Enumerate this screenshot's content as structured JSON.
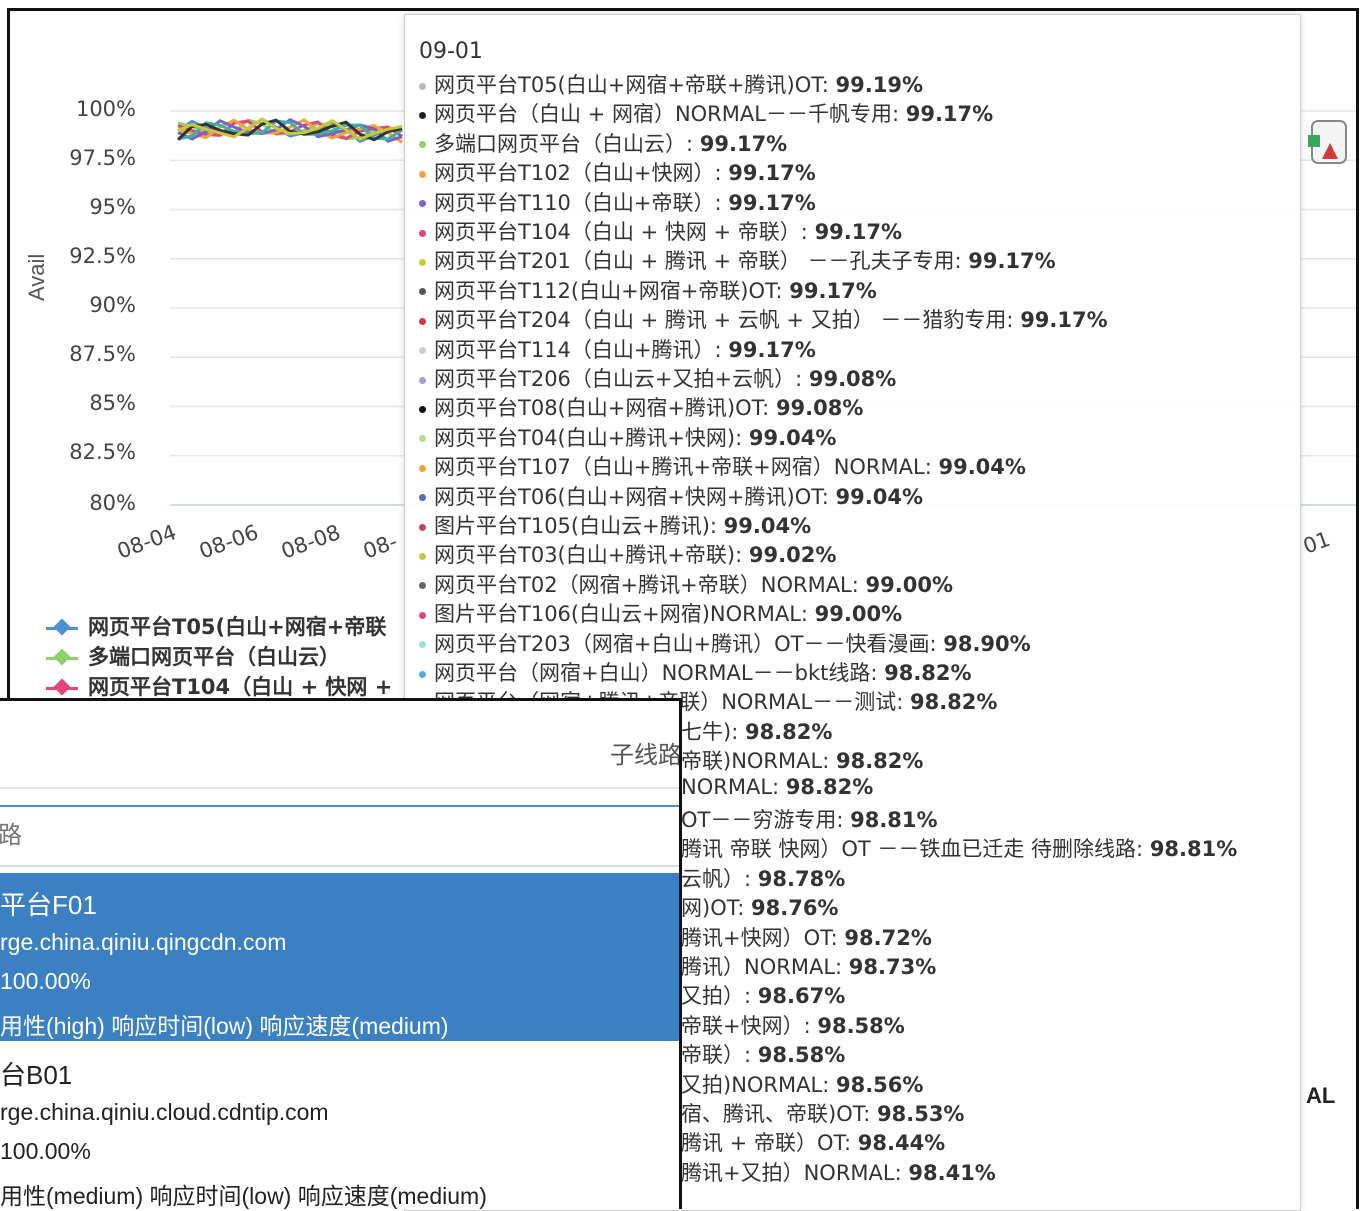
{
  "chart": {
    "y_axis_label": "Avail",
    "y_ticks": [
      "100%",
      "97.5%",
      "95%",
      "92.5%",
      "90%",
      "87.5%",
      "85%",
      "82.5%",
      "80%"
    ],
    "x_ticks": [
      "08-04",
      "08-06",
      "08-08",
      "08-",
      "01"
    ],
    "legend": [
      {
        "label": "网页平台T05(白山+网宿+帝联",
        "color": "#4f8fd6"
      },
      {
        "label": "多端口网页平台（白山云）",
        "color": "#8ed16a"
      },
      {
        "label": "网页平台T104（白山 + 快网 +",
        "color": "#e0457b"
      }
    ],
    "line_colors": [
      "#4f8fd6",
      "#8ed16a",
      "#e0457b",
      "#f2a33a",
      "#7a62c9",
      "#39b3a8",
      "#333333",
      "#c8c838"
    ]
  },
  "chart_data": {
    "type": "line",
    "ylabel": "Avail",
    "ylim": [
      80,
      100
    ],
    "yunit": "%"
  },
  "tooltip": {
    "date": "09-01",
    "rows": [
      {
        "prefix": "网页平台T05(白山+网宿+帝联+腾讯)OT: ",
        "value": "99.19%",
        "color": "#bbbbbb"
      },
      {
        "prefix": "网页平台（白山 + 网宿）NORMAL－－千帆专用: ",
        "value": "99.17%",
        "color": "#222222"
      },
      {
        "prefix": "多端口网页平台（白山云）: ",
        "value": "99.17%",
        "color": "#8ed16a"
      },
      {
        "prefix": "网页平台T102（白山+快网）: ",
        "value": "99.17%",
        "color": "#f2a33a"
      },
      {
        "prefix": "网页平台T110（白山+帝联）: ",
        "value": "99.17%",
        "color": "#7a62c9"
      },
      {
        "prefix": "网页平台T104（白山 + 快网 + 帝联）: ",
        "value": "99.17%",
        "color": "#e0457b"
      },
      {
        "prefix": "网页平台T201（白山 + 腾讯 + 帝联） －－孔夫子专用: ",
        "value": "99.17%",
        "color": "#c8c838"
      },
      {
        "prefix": "网页平台T112(白山+网宿+帝联)OT: ",
        "value": "99.17%",
        "color": "#555555"
      },
      {
        "prefix": "网页平台T204（白山 + 腾讯 + 云帆 + 又拍） －－猎豹专用: ",
        "value": "99.17%",
        "color": "#d43a3a"
      },
      {
        "prefix": "网页平台T114（白山+腾讯）: ",
        "value": "99.17%",
        "color": "#cccccc"
      },
      {
        "prefix": "网页平台T206（白山云+又拍+云帆）: ",
        "value": "99.08%",
        "color": "#9aa3d8"
      },
      {
        "prefix": "网页平台T08(白山+网宿+腾讯)OT: ",
        "value": "99.08%",
        "color": "#111111"
      },
      {
        "prefix": "网页平台T04(白山+腾讯+快网): ",
        "value": "99.04%",
        "color": "#b5e08a"
      },
      {
        "prefix": "网页平台T107（白山+腾讯+帝联+网宿）NORMAL: ",
        "value": "99.04%",
        "color": "#f2a33a"
      },
      {
        "prefix": "网页平台T06(白山+网宿+快网+腾讯)OT: ",
        "value": "99.04%",
        "color": "#4f6fc0"
      },
      {
        "prefix": "图片平台T105(白山云+腾讯): ",
        "value": "99.04%",
        "color": "#c0455b"
      },
      {
        "prefix": "网页平台T03(白山+腾讯+帝联): ",
        "value": "99.02%",
        "color": "#c8c838"
      },
      {
        "prefix": "网页平台T02（网宿+腾讯+帝联）NORMAL: ",
        "value": "99.00%",
        "color": "#666666"
      },
      {
        "prefix": "图片平台T106(白山云+网宿)NORMAL: ",
        "value": "99.00%",
        "color": "#e0457b"
      },
      {
        "prefix": "网页平台T203（网宿+白山+腾讯）OT－－快看漫画: ",
        "value": "98.90%",
        "color": "#9fdede"
      },
      {
        "prefix": "网页平台（网宿+白山）NORMAL－－bkt线路: ",
        "value": "98.82%",
        "color": "#4fb0d6"
      },
      {
        "prefix": "网页平台（网宿+腾讯+帝联）NORMAL－－测试: ",
        "value": "98.82%",
        "color": "#333333"
      },
      {
        "prefix": "七牛): ",
        "value": "98.82%",
        "color": "#ffffff"
      },
      {
        "prefix": "帝联)NORMAL: ",
        "value": "98.82%",
        "color": "#ffffff"
      },
      {
        "prefix": "NORMAL: ",
        "value": "98.82%",
        "color": "#ffffff"
      },
      {
        "prefix": "OT－－穷游专用: ",
        "value": "98.81%",
        "color": "#ffffff"
      },
      {
        "prefix": "腾讯 帝联 快网）OT －－铁血已迁走 待删除线路: ",
        "value": "98.81%",
        "color": "#ffffff"
      },
      {
        "prefix": "云帆）: ",
        "value": "98.78%",
        "color": "#ffffff"
      },
      {
        "prefix": "网)OT: ",
        "value": "98.76%",
        "color": "#ffffff"
      },
      {
        "prefix": "腾讯+快网）OT: ",
        "value": "98.72%",
        "color": "#ffffff"
      },
      {
        "prefix": "腾讯）NORMAL: ",
        "value": "98.73%",
        "color": "#ffffff"
      },
      {
        "prefix": "又拍）: ",
        "value": "98.67%",
        "color": "#ffffff"
      },
      {
        "prefix": "帝联+快网）: ",
        "value": "98.58%",
        "color": "#ffffff"
      },
      {
        "prefix": "帝联）: ",
        "value": "98.58%",
        "color": "#ffffff"
      },
      {
        "prefix": "又拍)NORMAL: ",
        "value": "98.56%",
        "color": "#ffffff"
      },
      {
        "prefix": "宿、腾讯、帝联)OT: ",
        "value": "98.53%",
        "color": "#ffffff"
      },
      {
        "prefix": "腾讯 + 帝联）OT: ",
        "value": "98.44%",
        "color": "#ffffff"
      },
      {
        "prefix": "腾讯+又拍）NORMAL: ",
        "value": "98.41%",
        "color": "#ffffff"
      }
    ]
  },
  "background_fragments": {
    "right_label": "AL"
  },
  "list_panel": {
    "title": "子线路",
    "search_placeholder": "路",
    "items": [
      {
        "name": "平台F01",
        "domain": "rge.china.qiniu.qingcdn.com",
        "availability": "100.00%",
        "tags": "用性(high) 响应时间(low) 响应速度(medium)",
        "selected": true
      },
      {
        "name": "台B01",
        "domain": "rge.china.qiniu.cloud.cdntip.com",
        "availability": "100.00%",
        "tags": "用性(medium) 响应时间(low) 响应速度(medium)",
        "selected": false
      }
    ]
  }
}
